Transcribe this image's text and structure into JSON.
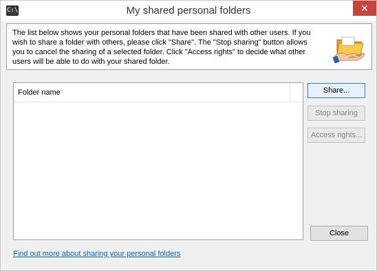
{
  "window": {
    "title": "My shared personal folders",
    "app_icon_label": "C:\\",
    "close_glyph": "✕"
  },
  "info": {
    "text": "The list below shows your personal folders that have been shared with other users. If you wish to share a folder with others, please click \"Share\". The \"Stop sharing\" button allows you to cancel the sharing of a selected folder. Click \"Access rights\" to decide what other users will be able to do with your shared folder.",
    "illustration_icon": "shared-folder-icon"
  },
  "list": {
    "columns": [
      "Folder name"
    ],
    "rows": []
  },
  "buttons": {
    "share": "Share...",
    "stop_sharing": "Stop sharing",
    "access_rights": "Access rights...",
    "close": "Close"
  },
  "footer": {
    "help_link": "Find out more about sharing your personal folders"
  },
  "colors": {
    "accent": "#3c7fb1",
    "close_button": "#c7443d",
    "link": "#0066cc"
  }
}
